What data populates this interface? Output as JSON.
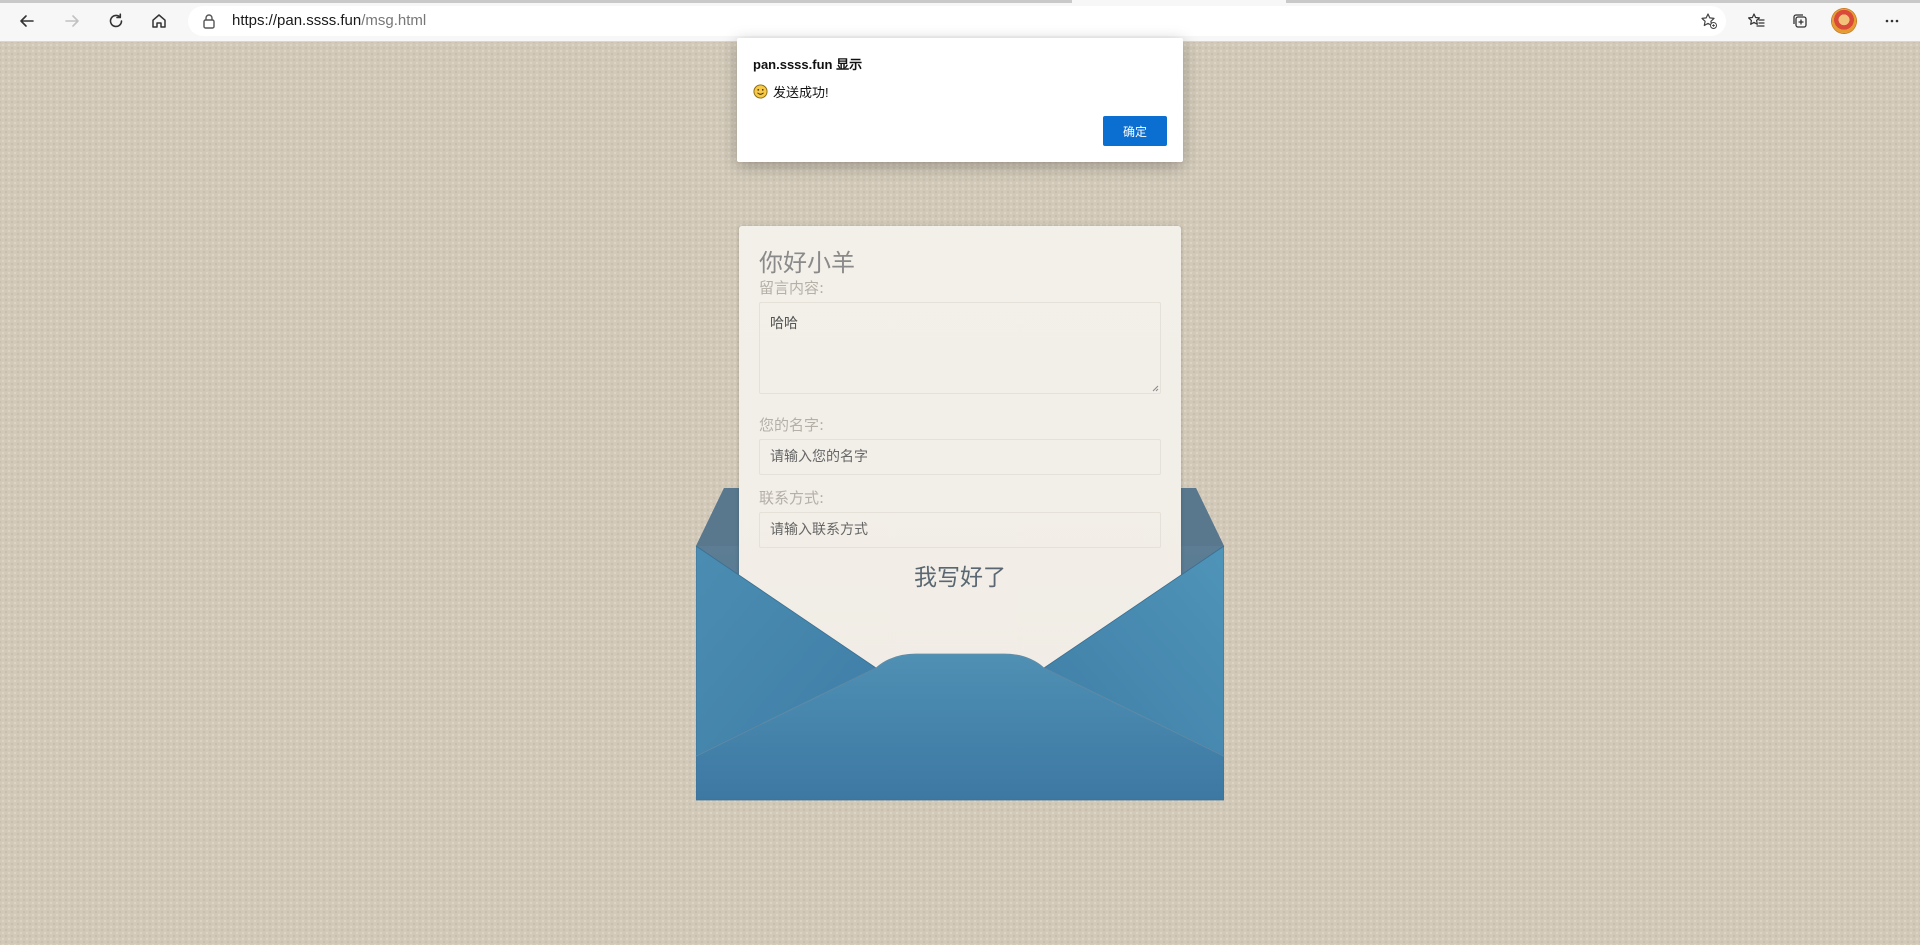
{
  "browser": {
    "url_host": "https://pan.ssss.fun",
    "url_path": "/msg.html",
    "icons": [
      "back-icon",
      "forward-icon",
      "refresh-icon",
      "home-icon",
      "lock-icon",
      "add-favorite-icon",
      "favorites-icon",
      "collections-icon",
      "profile-avatar",
      "more-icon"
    ]
  },
  "dialog": {
    "title": "pan.ssss.fun 显示",
    "message": "发送成功!",
    "ok_label": "确定",
    "icon": "smiley-icon",
    "accent_color": "#0a6fd1"
  },
  "letter": {
    "title": "你好小羊",
    "message_label": "留言内容:",
    "message_value": "哈哈",
    "name_label": "您的名字:",
    "name_placeholder": "请输入您的名字",
    "contact_label": "联系方式:",
    "contact_placeholder": "请输入联系方式",
    "submit_label": "我写好了"
  },
  "colors": {
    "page_background": "#d2c9b8",
    "envelope_blue": "#4a8fb3",
    "letter_paper": "#f3f0ea"
  }
}
